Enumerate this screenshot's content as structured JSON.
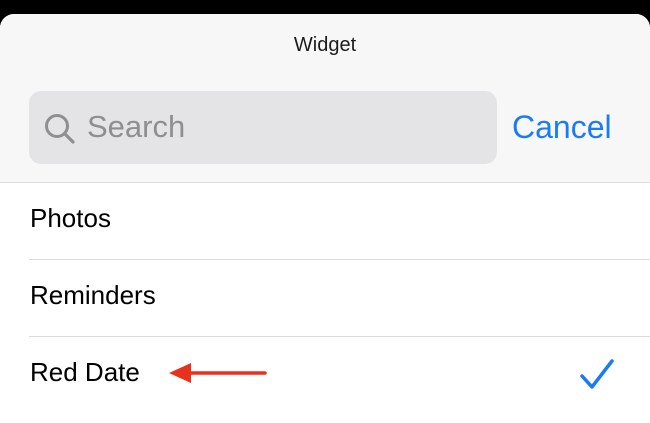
{
  "sheet": {
    "title": "Widget"
  },
  "search": {
    "placeholder": "Search",
    "value": "",
    "icon": "magnifying-glass-icon"
  },
  "cancel_label": "Cancel",
  "list": {
    "items": [
      {
        "label": "Photos",
        "selected": false
      },
      {
        "label": "Reminders",
        "selected": false
      },
      {
        "label": "Red Date",
        "selected": true
      }
    ]
  },
  "colors": {
    "accent": "#1a7cf5",
    "annotation_arrow": "#e8321e",
    "header_bg": "#f7f7f7",
    "search_bg": "#e4e4e6"
  }
}
